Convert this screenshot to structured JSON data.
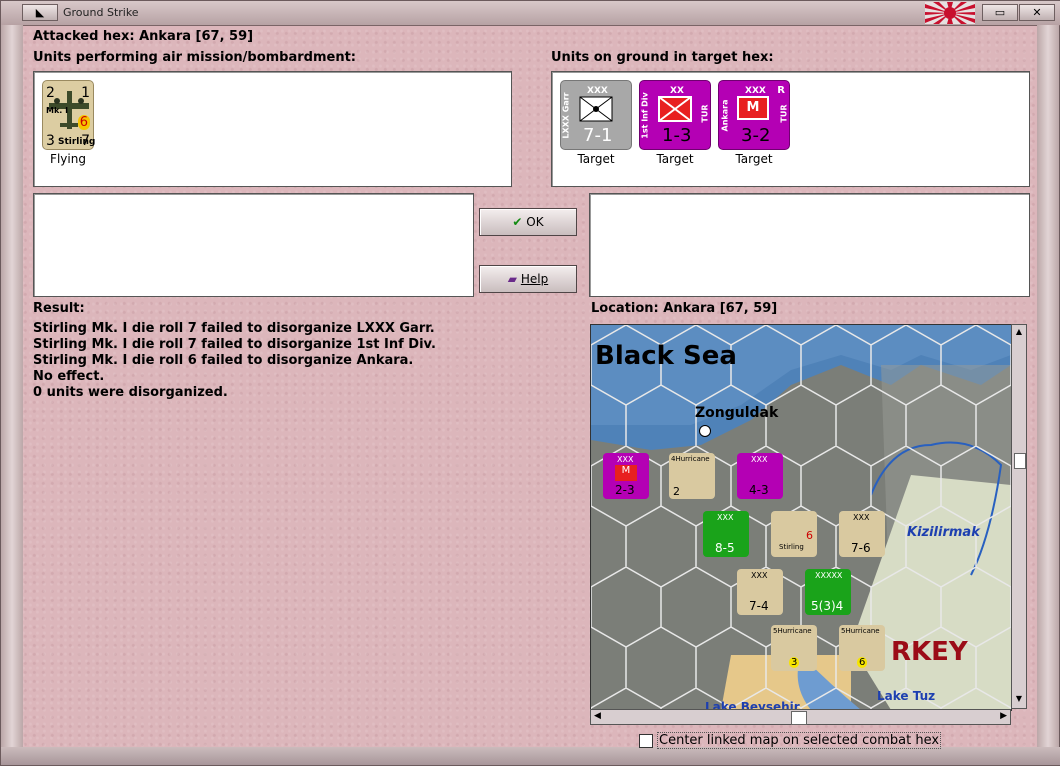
{
  "window": {
    "title": "Ground Strike"
  },
  "header": {
    "attacked_hex": "Attacked hex: Ankara  [67, 59]"
  },
  "air_panel": {
    "label": "Units performing air mission/bombardment:",
    "units": [
      {
        "name": "Stirling",
        "mk": "Mk. I",
        "attack": "2",
        "range": "1",
        "defense": "3",
        "move": "7",
        "strength": "6",
        "status": "Flying"
      }
    ]
  },
  "ground_panel": {
    "label": "Units on ground in target hex:",
    "units": [
      {
        "size": "XXX",
        "side_text": "LXXX Garr",
        "values": "7-1",
        "status": "Target",
        "color": "#a8a8a8"
      },
      {
        "size": "XX",
        "side_text": "1st Inf Div",
        "nation": "TUR",
        "values": "1-3",
        "status": "Target",
        "color": "#b400b4"
      },
      {
        "size": "XXX",
        "side_text": "Ankara",
        "nation": "TUR",
        "corner": "R",
        "symbol": "M",
        "values": "3-2",
        "status": "Target",
        "color": "#b400b4"
      }
    ]
  },
  "buttons": {
    "ok": "OK",
    "help": "Help"
  },
  "result": {
    "label": "Result:",
    "lines": [
      "Stirling Mk. I die roll 7 failed to disorganize LXXX Garr.",
      "Stirling Mk. I die roll 7 failed to disorganize 1st Inf Div.",
      "Stirling Mk. I die roll 6 failed to disorganize Ankara.",
      "No effect.",
      "0 units were disorganized."
    ]
  },
  "location": {
    "label": "Location:  Ankara  [67, 59]"
  },
  "map": {
    "labels": {
      "sea": "Black Sea",
      "city": "Zonguldak",
      "river": "Kizilirmak",
      "country": "RKEY",
      "lake": "Lake Tuz",
      "lake2": "Lake Beysehir"
    },
    "counters": [
      {
        "top": "XXX",
        "mid": "M",
        "vals": "2-3",
        "color": "#b400b4"
      },
      {
        "top": "4Hurricane",
        "vals": "2",
        "color": "#d9c9a0"
      },
      {
        "top": "XXX",
        "vals": "4-3",
        "color": "#b400b4"
      },
      {
        "top": "XXX",
        "vals": "8-5",
        "color": "#1aa31a"
      },
      {
        "top": "Stirling",
        "vals": "6",
        "color": "#d9c9a0"
      },
      {
        "top": "XXX",
        "vals": "7-6",
        "color": "#d9c9a0"
      },
      {
        "top": "XXX",
        "vals": "7-4",
        "color": "#d9c9a0"
      },
      {
        "top": "XXXXX",
        "vals": "5(3)4",
        "color": "#1aa31a"
      },
      {
        "top": "5Hurricane",
        "vals": "3",
        "color": "#d9c9a0"
      },
      {
        "top": "5Hurricane",
        "vals": "6",
        "color": "#d9c9a0"
      }
    ]
  },
  "options": {
    "center_map": "Center linked map on selected combat hex"
  }
}
